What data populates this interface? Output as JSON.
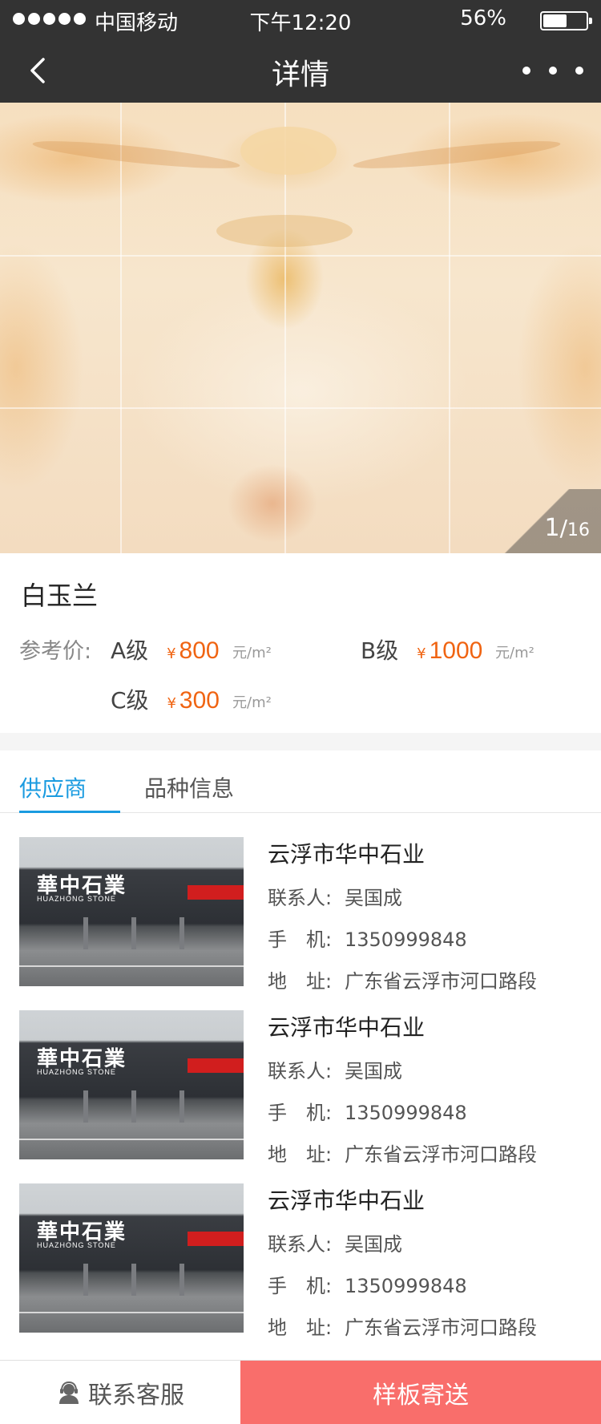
{
  "status_bar": {
    "carrier": "中国移动",
    "time": "下午12:20",
    "battery": "56%",
    "battery_level": 0.56
  },
  "nav": {
    "title": "详情"
  },
  "gallery": {
    "current": "1",
    "total": "16"
  },
  "product": {
    "name": "白玉兰",
    "price_label": "参考价:",
    "yen": "¥",
    "prices": [
      {
        "grade": "A级",
        "price": "800",
        "unit": "元/m²"
      },
      {
        "grade": "B级",
        "price": "1000",
        "unit": "元/m²"
      },
      {
        "grade": "C级",
        "price": "300",
        "unit": "元/m²"
      }
    ]
  },
  "tabs": [
    "供应商",
    "品种信息"
  ],
  "suppliers": [
    {
      "name": "云浮市华中石业",
      "contact_label": "联系人:",
      "contact": "吴国成",
      "phone_label": "手　机:",
      "phone": "1350999848",
      "address_label": "地　址:",
      "address": "广东省云浮市河口路段",
      "sign": "華中石業",
      "sign_en": "HUAZHONG STONE"
    },
    {
      "name": "云浮市华中石业",
      "contact_label": "联系人:",
      "contact": "吴国成",
      "phone_label": "手　机:",
      "phone": "1350999848",
      "address_label": "地　址:",
      "address": "广东省云浮市河口路段",
      "sign": "華中石業",
      "sign_en": "HUAZHONG STONE"
    },
    {
      "name": "云浮市华中石业",
      "contact_label": "联系人:",
      "contact": "吴国成",
      "phone_label": "手　机:",
      "phone": "1350999848",
      "address_label": "地　址:",
      "address": "广东省云浮市河口路段",
      "sign": "華中石業",
      "sign_en": "HUAZHONG STONE"
    }
  ],
  "bottom_bar": {
    "service": "联系客服",
    "sample": "样板寄送"
  },
  "colors": {
    "header_bg": "#333333",
    "accent_blue": "#1a9be0",
    "price_orange": "#f06412",
    "sample_button": "#f96e6b"
  }
}
